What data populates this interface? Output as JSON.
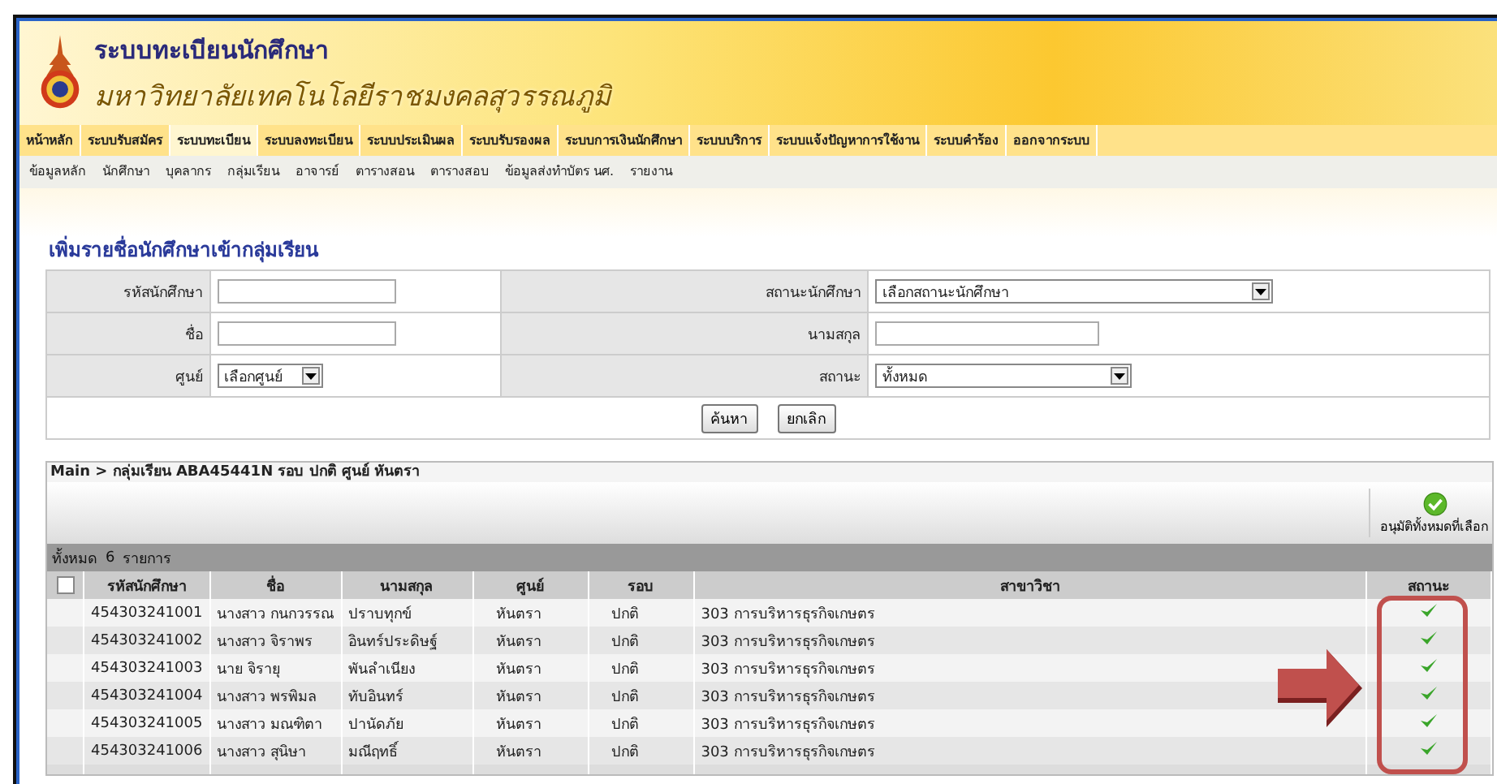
{
  "header": {
    "title": "ระบบทะเบียนนักศึกษา",
    "subtitle": "มหาวิทยาลัยเทคโนโลยีราชมงคลสุวรรณภูมิ"
  },
  "menu": [
    {
      "label": "หน้าหลัก",
      "selected": false
    },
    {
      "label": "ระบบรับสมัคร",
      "selected": false
    },
    {
      "label": "ระบบทะเบียน",
      "selected": true
    },
    {
      "label": "ระบบลงทะเบียน",
      "selected": false
    },
    {
      "label": "ระบบประเมินผล",
      "selected": false
    },
    {
      "label": "ระบบรับรองผล",
      "selected": false
    },
    {
      "label": "ระบบการเงินนักศึกษา",
      "selected": false
    },
    {
      "label": "ระบบบริการ",
      "selected": false
    },
    {
      "label": "ระบบแจ้งปัญหาการใช้งาน",
      "selected": false
    },
    {
      "label": "ระบบคำร้อง",
      "selected": false
    },
    {
      "label": "ออกจากระบบ",
      "selected": false
    }
  ],
  "submenu": [
    "ข้อมูลหลัก",
    "นักศึกษา",
    "บุคลากร",
    "กลุ่มเรียน",
    "อาจารย์",
    "ตารางสอน",
    "ตารางสอบ",
    "ข้อมูลส่งทำบัตร นศ.",
    "รายงาน"
  ],
  "page_title": "เพิ่มรายชื่อนักศึกษาเข้ากลุ่มเรียน",
  "form": {
    "rows": [
      [
        {
          "label": "รหัสนักศึกษา",
          "kind": "text"
        },
        {
          "label": "สถานะนักศึกษา",
          "kind": "select",
          "value": "เลือกสถานะนักศึกษา"
        }
      ],
      [
        {
          "label": "ชื่อ",
          "kind": "text"
        },
        {
          "label": "นามสกุล",
          "kind": "text"
        }
      ],
      [
        {
          "label": "ศูนย์",
          "kind": "select",
          "value": "เลือกศูนย์"
        },
        {
          "label": "สถานะ",
          "kind": "select",
          "value": "ทั้งหมด"
        }
      ]
    ],
    "buttons": [
      "ค้นหา",
      "ยกเลิก"
    ]
  },
  "breadcrumb": "Main > กลุ่มเรียน ABA45441N รอบ ปกติ ศูนย์ หันตรา",
  "approve_button": "อนุมัติทั้งหมดที่เลือก",
  "total": {
    "label": "ทั้งหมด",
    "count": "6",
    "unit": "รายการ"
  },
  "table": {
    "select_all_checked": false,
    "columns": [
      "รหัสนักศึกษา",
      "ชื่อ",
      "นามสกุล",
      "ศูนย์",
      "รอบ",
      "สาขาวิชา",
      "สถานะ"
    ],
    "rows": [
      {
        "id": "454303241001",
        "name": "นางสาว กนกวรรณ",
        "surname": "ปราบทุกข์",
        "center": "หันตรา",
        "round": "ปกติ",
        "program": "303 การบริหารธุรกิจเกษตร",
        "approved": true
      },
      {
        "id": "454303241002",
        "name": "นางสาว จิราพร",
        "surname": "อินทร์ประดิษฐ์",
        "center": "หันตรา",
        "round": "ปกติ",
        "program": "303 การบริหารธุรกิจเกษตร",
        "approved": true
      },
      {
        "id": "454303241003",
        "name": "นาย จิรายุ",
        "surname": "พันลำเนียง",
        "center": "หันตรา",
        "round": "ปกติ",
        "program": "303 การบริหารธุรกิจเกษตร",
        "approved": true
      },
      {
        "id": "454303241004",
        "name": "นางสาว พรพิมล",
        "surname": "ทับอินทร์",
        "center": "หันตรา",
        "round": "ปกติ",
        "program": "303 การบริหารธุรกิจเกษตร",
        "approved": true
      },
      {
        "id": "454303241005",
        "name": "นางสาว มณฑิตา",
        "surname": "ปานัดภัย",
        "center": "หันตรา",
        "round": "ปกติ",
        "program": "303 การบริหารธุรกิจเกษตร",
        "approved": true
      },
      {
        "id": "454303241006",
        "name": "นางสาว สุนิษา",
        "surname": "มณีฤทธิ์",
        "center": "หันตรา",
        "round": "ปกติ",
        "program": "303 การบริหารธุรกิจเกษตร",
        "approved": true
      }
    ]
  }
}
